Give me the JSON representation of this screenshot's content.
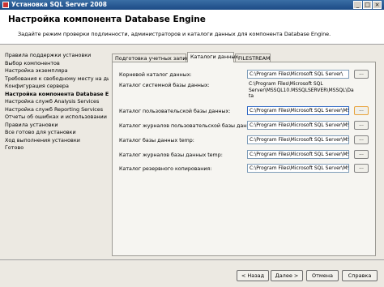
{
  "window": {
    "title": "Установка SQL Server 2008"
  },
  "header": {
    "title": "Настройка компонента Database Engine",
    "subtitle": "Задайте режим проверки подлинности, администраторов и каталоги данных для компонента Database Engine."
  },
  "nav": {
    "items": [
      {
        "label": "Правила поддержки установки"
      },
      {
        "label": "Выбор компонентов"
      },
      {
        "label": "Настройка экземпляра"
      },
      {
        "label": "Требования к свободному месту на диске"
      },
      {
        "label": "Конфигурация сервера"
      },
      {
        "label": "Настройка компонента Database Engine"
      },
      {
        "label": "Настройка служб Analysis Services"
      },
      {
        "label": "Настройка служб Reporting Services"
      },
      {
        "label": "Отчеты об ошибках и использовании"
      },
      {
        "label": "Правила установки"
      },
      {
        "label": "Все готово для установки"
      },
      {
        "label": "Ход выполнения установки"
      },
      {
        "label": "Готово"
      }
    ]
  },
  "tabs": [
    {
      "label": "Подготовка учетных записей"
    },
    {
      "label": "Каталоги данных"
    },
    {
      "label": "FILESTREAM"
    }
  ],
  "fields": {
    "root": {
      "label": "Корневой каталог данных:",
      "value": "C:\\Program Files\\Microsoft SQL Server\\"
    },
    "system": {
      "label": "Каталог системной базы данных:",
      "lines": [
        "C:\\Program Files\\Microsoft SQL",
        "Server\\MSSQL10.MSSQLSERVER\\MSSQL\\Da",
        "ta"
      ]
    },
    "userdb": {
      "label": "Каталог пользовательской базы данных:",
      "value": "C:\\Program Files\\Microsoft SQL Server\\MSSQL"
    },
    "userlog": {
      "label": "Каталог журналов пользовательской базы данных:",
      "value": "C:\\Program Files\\Microsoft SQL Server\\MSSQL"
    },
    "tempdb": {
      "label": "Каталог базы данных temp:",
      "value": "C:\\Program Files\\Microsoft SQL Server\\MSSQL"
    },
    "templog": {
      "label": "Каталог журналов базы данных temp:",
      "value": "C:\\Program Files\\Microsoft SQL Server\\MSSQL"
    },
    "backup": {
      "label": "Каталог резервного копирования:",
      "value": "C:\\Program Files\\Microsoft SQL Server\\MSSQL"
    }
  },
  "browse_label": "...",
  "buttons": {
    "back": "< Назад",
    "next": "Далее >",
    "cancel": "Отмена",
    "help": "Справка"
  }
}
